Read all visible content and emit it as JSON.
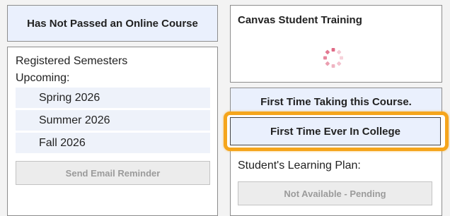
{
  "left_header": {
    "label": "Has Not Passed an Online Course"
  },
  "semesters": {
    "title": "Registered Semesters",
    "upcoming_label": "Upcoming:",
    "items": [
      {
        "label": "Spring 2026"
      },
      {
        "label": "Summer 2026"
      },
      {
        "label": "Fall 2026"
      }
    ],
    "button_label": "Send Email Reminder"
  },
  "training": {
    "title": "Canvas Student Training"
  },
  "course_badge": {
    "label": "First Time Taking this Course."
  },
  "college_badge": {
    "label": "First Time Ever In College"
  },
  "learning_plan": {
    "label": "Student's Learning Plan:",
    "button_label": "Not Available - Pending"
  },
  "colors": {
    "highlight": "#f5a51c",
    "header_bg": "#eaf0fd",
    "spinner": "#e06a86"
  }
}
